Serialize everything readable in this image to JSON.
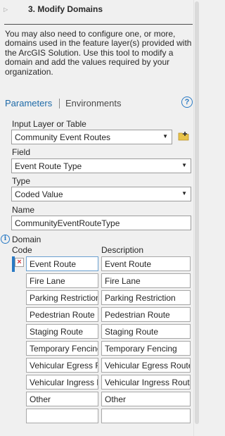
{
  "step": {
    "title": "3.  Modify Domains",
    "expander": "▷"
  },
  "description": "You may also need to configure one, or more, domains used in the feature layer(s) provided with the ArcGIS Solution. Use this tool to modify a domain and add the values required by your organization.",
  "tabs": {
    "parameters": "Parameters",
    "environments": "Environments",
    "help": "?"
  },
  "fields": {
    "input_layer": {
      "label": "Input Layer or Table",
      "value": "Community Event Routes"
    },
    "field": {
      "label": "Field",
      "value": "Event Route Type"
    },
    "type": {
      "label": "Type",
      "value": "Coded Value"
    },
    "name": {
      "label": "Name",
      "value": "CommunityEventRouteType"
    }
  },
  "domain": {
    "label": "Domain",
    "info_icon": "i",
    "col_code": "Code",
    "col_description": "Description",
    "delete_icon": "×",
    "rows": [
      {
        "code": "Event Route",
        "description": "Event Route"
      },
      {
        "code": "Fire Lane",
        "description": "Fire Lane"
      },
      {
        "code": "Parking Restriction",
        "description": "Parking Restriction"
      },
      {
        "code": "Pedestrian Route",
        "description": "Pedestrian Route"
      },
      {
        "code": "Staging Route",
        "description": "Staging Route"
      },
      {
        "code": "Temporary Fencing",
        "description": "Temporary Fencing"
      },
      {
        "code": "Vehicular Egress Route",
        "description": "Vehicular Egress Route"
      },
      {
        "code": "Vehicular Ingress Route",
        "description": "Vehicular Ingress Route"
      },
      {
        "code": "Other",
        "description": "Other"
      },
      {
        "code": "",
        "description": ""
      }
    ]
  },
  "colors": {
    "accent": "#1e6aa8",
    "delete": "#d13438",
    "folder": "#e8c34a"
  }
}
